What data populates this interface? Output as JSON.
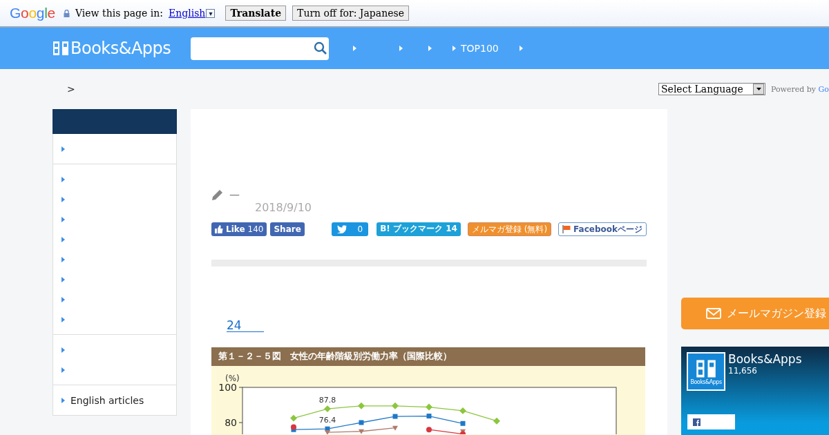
{
  "translate_bar": {
    "logo": "Google",
    "prompt": "View this page in:",
    "language": "English",
    "dropdown_glyph": "▾",
    "buttons": [
      "Translate",
      "Turn off for: Japanese"
    ]
  },
  "header": {
    "logo": "Books&Apps",
    "nav": [
      {
        "kind": "arrow"
      },
      {
        "kind": "arrow"
      },
      {
        "kind": "arrow"
      },
      {
        "kind": "arrow",
        "label": "TOP100"
      },
      {
        "kind": "arrow"
      }
    ]
  },
  "breadcrumb": ">",
  "language_select": {
    "value": "Select Language",
    "powered_by": "Powered by",
    "brand": "Go"
  },
  "sidebar": {
    "groups": [
      {
        "items": [
          {
            "kind": "arrow"
          }
        ]
      },
      {
        "items": [
          {
            "kind": "arrow"
          },
          {
            "kind": "arrow"
          },
          {
            "kind": "arrow"
          },
          {
            "kind": "arrow"
          },
          {
            "kind": "arrow"
          },
          {
            "kind": "arrow"
          },
          {
            "kind": "arrow"
          },
          {
            "kind": "arrow"
          }
        ]
      },
      {
        "items": [
          {
            "kind": "arrow"
          },
          {
            "kind": "arrow"
          }
        ]
      },
      {
        "items": [
          {
            "kind": "arrow",
            "label": "English articles"
          }
        ]
      }
    ]
  },
  "article": {
    "author": "—",
    "date": "2018/9/10",
    "share": [
      {
        "kind": "like",
        "label": "Like",
        "count": "140"
      },
      {
        "kind": "share",
        "label": "Share"
      },
      {
        "kind": "tweet",
        "count": "0"
      },
      {
        "kind": "hatena",
        "label": "B! ブックマーク 14"
      },
      {
        "kind": "mail",
        "label": "メルマガ登録 (無料)"
      },
      {
        "kind": "facebook",
        "label": "Facebookページ"
      }
    ],
    "link": "24",
    "figure": {
      "title": "第１－２－５図　女性の年齢階級別労働力率（国際比較）",
      "chart_data": {
        "type": "line",
        "ylabel": "(%)",
        "ylim": [
          73,
          100
        ],
        "yticks": [
          80,
          100
        ],
        "series": [
          {
            "color": "#8cc63f",
            "marker": "diamond",
            "values": [
              null,
              82.5,
              87.8,
              89.5,
              89.5,
              88.8,
              86.7,
              80.9,
              null
            ]
          },
          {
            "color": "#1f78c8",
            "marker": "square",
            "values": [
              null,
              76,
              76.4,
              80,
              83.5,
              83.7,
              79.5,
              null,
              null
            ]
          },
          {
            "color": "#b07a6a",
            "marker": "triangle",
            "values": [
              null,
              null,
              74.5,
              75,
              77,
              null,
              75,
              null,
              null
            ]
          },
          {
            "color": "#d9363e",
            "marker": "circle",
            "values": [
              null,
              77.5,
              null,
              null,
              null,
              76,
              73.5,
              null,
              null
            ]
          }
        ],
        "annotations": [
          {
            "y": 87.8,
            "text": "87.8"
          },
          {
            "y": 76.4,
            "text": "76.4"
          }
        ]
      }
    }
  },
  "right": {
    "mail_button": "メールマガジン登録",
    "fb_widget": {
      "name": "Books&Apps",
      "count": "11,656",
      "logo_caption": "Books&Apps"
    }
  }
}
